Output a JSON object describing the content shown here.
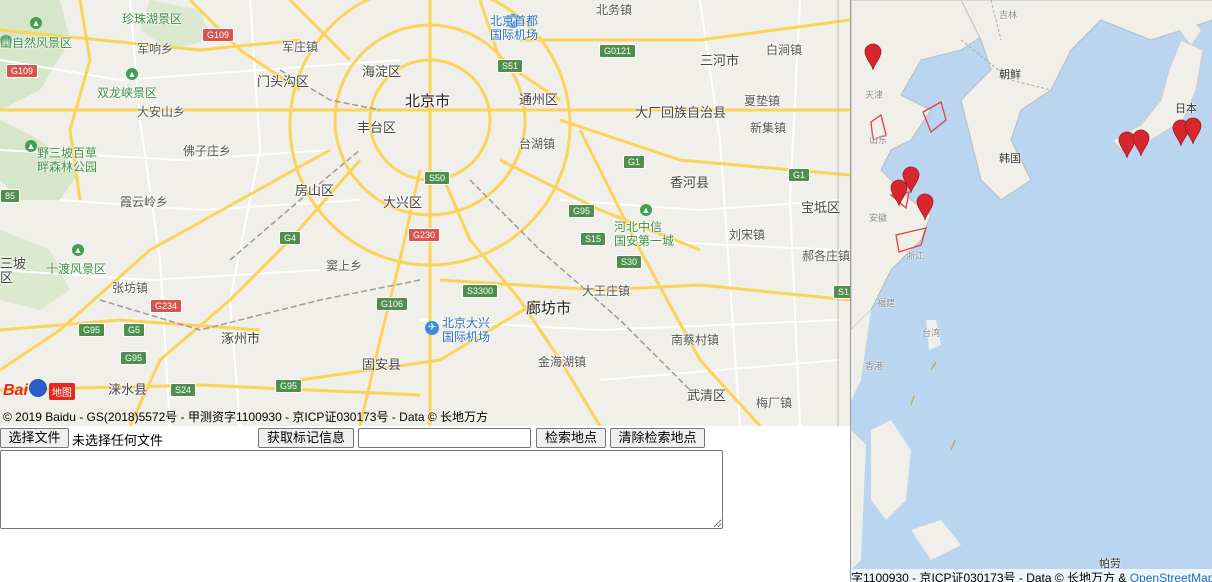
{
  "left_map": {
    "labels": {
      "zhuzhu_lake": "珍珠湖景区",
      "mountain_park": "山自然风景区",
      "junyin": "军响乡",
      "tangtai": "军庄镇",
      "mentougou": "门头沟区",
      "shuanglong": "双龙峡景区",
      "daanshan": "大安山乡",
      "fozi": "佛子庄乡",
      "yesan": "野三坡百草\n畔森林公园",
      "xialing": "霞云岭乡",
      "sanpo": "三坡\n区",
      "shidu": "十渡风景区",
      "zhangfang": "张坊镇",
      "zhuozhou": "涿州市",
      "laishui": "涞水县",
      "haidian": "海淀区",
      "beijing": "北京市",
      "fengtai": "丰台区",
      "fangshan": "房山区",
      "daxing": "大兴区",
      "doudian": "窦上乡",
      "guan": "固安县",
      "tongzhou": "通州区",
      "taihu": "台湖镇",
      "airport": "北京首都\n国际机场",
      "beiwu": "北务镇",
      "sanhe": "三河市",
      "baihu": "白涧镇",
      "dachang": "大厂回族自治县",
      "xiazhuang": "夏垫镇",
      "xinji": "新集镇",
      "xianghe": "香河县",
      "hebei_zhongxin": "河北中信\n国安第一城",
      "liuxiu": "刘宋镇",
      "baodi": "宝坻区",
      "haobei": "郝各庄镇",
      "langfang": "廊坊市",
      "dawang": "大王庄镇",
      "nancun": "南蔡村镇",
      "jinhai": "金海湖镇",
      "wuqing": "武清区",
      "meichang": "梅厂镇",
      "daxing_airport": "北京大兴\n国际机场"
    },
    "shields": {
      "g109a": "G109",
      "g109b": "G109",
      "s51": "S51",
      "g0121": "G0121",
      "g1a": "G1",
      "g1b": "G1",
      "s50": "S50",
      "g95a": "G95",
      "g95b": "G95",
      "g95c": "G95",
      "g95d": "G95",
      "g4": "G4",
      "g230": "G230",
      "s15": "S15",
      "s30": "S30",
      "s3300": "S3300",
      "g106": "G106",
      "g234": "G234",
      "g5": "G5",
      "s24": "S24",
      "s1": "S1",
      "n85": "85"
    },
    "logo": {
      "text": "Bai",
      "ditu": "地图"
    },
    "copyright": "© 2019 Baidu - GS(2018)5572号 - 甲测资字1100930 - 京ICP证030173号 - Data © 长地万方"
  },
  "controls": {
    "choose_file": "选择文件",
    "file_status": "未选择任何文件",
    "get_markers": "获取标记信息",
    "search_value": "",
    "search_button": "检索地点",
    "clear_button": "清除检索地点",
    "textarea_value": ""
  },
  "right_map": {
    "labels": {
      "jilin": "吉林",
      "chaoxian": "朝鲜",
      "hanguo": "韩国",
      "riben": "日本",
      "tianjin": "天津",
      "shandong": "山东",
      "anhui": "安徽",
      "zhejiang": "浙江",
      "fujian": "福建",
      "taiwan": "台湾",
      "xianggang": "香港",
      "palao": "帕劳"
    },
    "copyright_text": "字1100930 - 京ICP证030173号 - Data © 长地万方 & ",
    "copyright_link": "OpenStreetMap"
  },
  "colors": {
    "water": "#b9d5ef",
    "land": "#f1efe9",
    "road_major": "#fbd35a",
    "highway_shield": "#4f8f4d",
    "marker": "#d8262e"
  }
}
